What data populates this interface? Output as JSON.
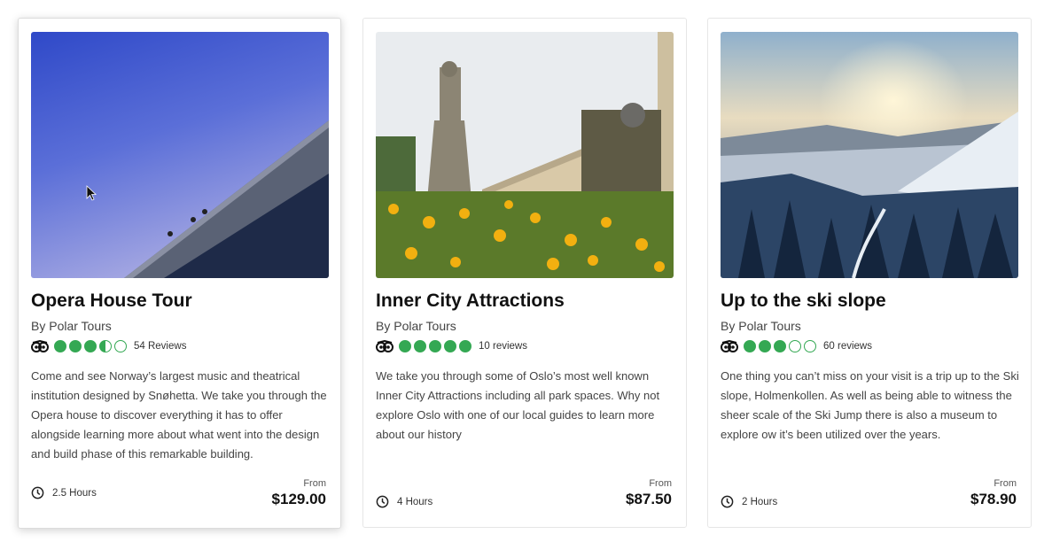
{
  "cards": [
    {
      "title": "Opera House Tour",
      "byline": "By Polar Tours",
      "rating": 3.5,
      "reviews_label": "54 Reviews",
      "description": "Come and see Norway’s largest music and theatrical institution designed by Snøhetta. We take you through the Opera house to discover everything it has to offer alongside learning more about what went into the design and build phase of this remarkable building.",
      "duration": "2.5 Hours",
      "from_label": "From",
      "price": "$129.00",
      "image": "opera-house-photo"
    },
    {
      "title": "Inner City Attractions",
      "byline": "By Polar Tours",
      "rating": 5,
      "reviews_label": "10 reviews",
      "description": "We take you through some of Oslo’s most well known Inner City Attractions including all park spaces. Why not explore Oslo with one of our local guides to learn more about our history",
      "duration": "4 Hours",
      "from_label": "From",
      "price": "$87.50",
      "image": "statue-garden-photo"
    },
    {
      "title": "Up to the ski slope",
      "byline": "By Polar Tours",
      "rating": 3,
      "reviews_label": "60 reviews",
      "description": "One thing you can’t miss on your visit is a trip up to the Ski slope, Holmenkollen. As well as being able to witness the sheer scale of the Ski Jump there is also a museum to explore ow it’s been utilized over the years.",
      "duration": "2 Hours",
      "from_label": "From",
      "price": "$78.90",
      "image": "ski-slope-photo"
    }
  ],
  "icons": {
    "review_site": "owl-icon",
    "duration": "clock-icon",
    "rating": "rating-dot-icon"
  },
  "colors": {
    "rating_green": "#34a853",
    "title": "#111111",
    "body_text": "#444444"
  }
}
